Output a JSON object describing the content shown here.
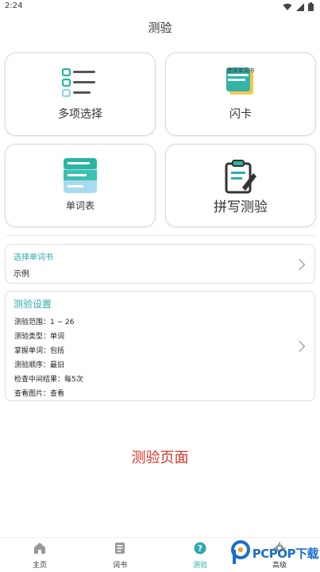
{
  "status": {
    "time": "2:24"
  },
  "header": {
    "title": "测验"
  },
  "modes": {
    "multiple_choice": "多项选择",
    "flashcard": "闪卡",
    "flashcard_icon_text": "选择单词书",
    "word_list": "单词表",
    "spelling": "拼写测验"
  },
  "book": {
    "label": "选择单词书",
    "value": "示例"
  },
  "settings": {
    "title": "测验设置",
    "rows": [
      "测验范围：1 ~ 26",
      "测验类型：单词",
      "掌握单词：包括",
      "测验顺序：最旧",
      "检查中间结果：每5次",
      "查看图片：查看"
    ]
  },
  "caption": "测验页面",
  "nav": {
    "home": "主页",
    "books": "词书",
    "quiz": "测验",
    "advanced": "高级"
  },
  "watermark": {
    "text": "PCPOP下载"
  },
  "colors": {
    "accent": "#2ba9a9",
    "caption": "#d9342b",
    "brand": "#1a6fc9"
  }
}
